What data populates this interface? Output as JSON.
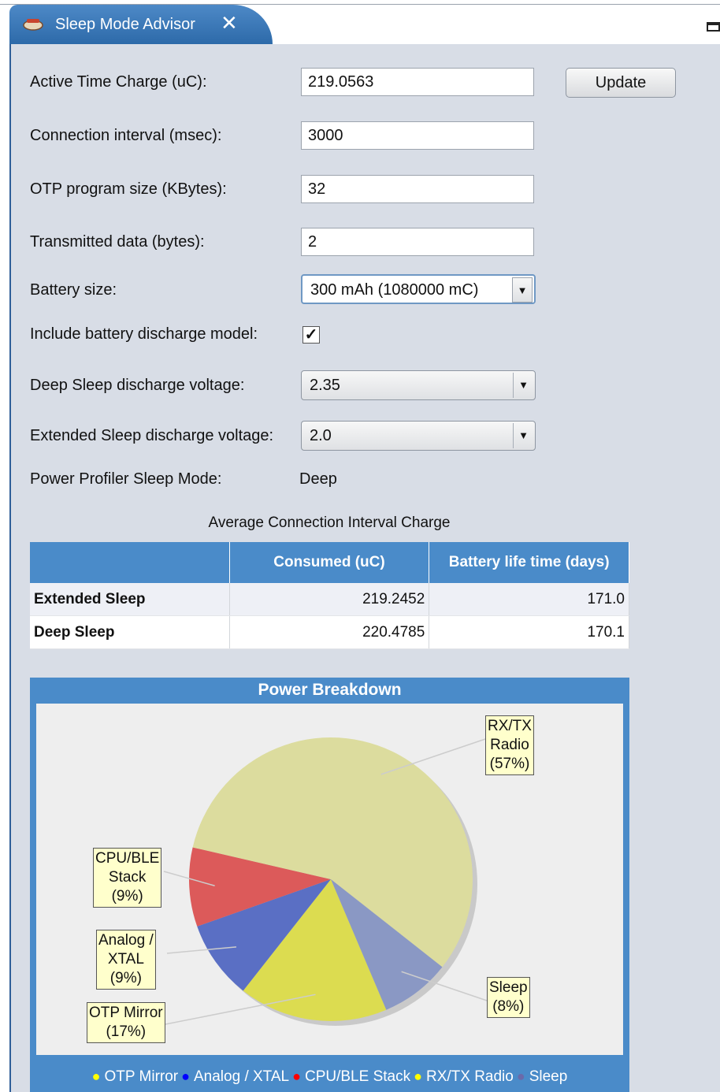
{
  "tab": {
    "icon": "app-icon",
    "title": "Sleep Mode Advisor",
    "close": "✕"
  },
  "fields": {
    "active_charge": {
      "label": "Active Time Charge (uC):",
      "value": "219.0563"
    },
    "conn_interval": {
      "label": "Connection interval (msec):",
      "value": "3000"
    },
    "otp_size": {
      "label": "OTP program size (KBytes):",
      "value": "32"
    },
    "tx_data": {
      "label": "Transmitted data (bytes):",
      "value": "2"
    },
    "battery": {
      "label": "Battery size:",
      "value": "300 mAh (1080000 mC)"
    },
    "discharge_model": {
      "label": "Include battery discharge model:",
      "checked": true,
      "mark": "✓"
    },
    "deep_voltage": {
      "label": "Deep Sleep discharge voltage:",
      "value": "2.35"
    },
    "ext_voltage": {
      "label": "Extended Sleep discharge voltage:",
      "value": "2.0"
    },
    "profiler_mode": {
      "label": "Power Profiler Sleep Mode:",
      "value": "Deep"
    }
  },
  "update_button": "Update",
  "table": {
    "caption": "Average Connection Interval Charge",
    "headers": [
      "",
      "Consumed (uC)",
      "Battery life time (days)"
    ],
    "rows": [
      [
        "Extended Sleep",
        "219.2452",
        "171.0"
      ],
      [
        "Deep Sleep",
        "220.4785",
        "170.1"
      ]
    ]
  },
  "chart_data": {
    "type": "pie",
    "title": "Power Breakdown",
    "slices": [
      {
        "name": "OTP Mirror",
        "label": "OTP Mirror (17%)",
        "value": 17,
        "color": "#dcdc50",
        "legend_dot": "#ffff00"
      },
      {
        "name": "Analog / XTAL",
        "label": "Analog / XTAL (9%)",
        "value": 9,
        "color": "#5a6fc4",
        "legend_dot": "#0000ff"
      },
      {
        "name": "CPU/BLE Stack",
        "label": "CPU/BLE Stack (9%)",
        "value": 9,
        "color": "#dc5a5a",
        "legend_dot": "#ff0000"
      },
      {
        "name": "RX/TX Radio",
        "label": "RX/TX Radio (57%)",
        "value": 57,
        "color": "#dcdc9e",
        "legend_dot": "#ffff00"
      },
      {
        "name": "Sleep",
        "label": "Sleep (8%)",
        "value": 8,
        "color": "#8a98c4",
        "legend_dot": "#6a6aaa"
      }
    ],
    "legend_position": "bottom",
    "callout_text": {
      "OTP Mirror": [
        "OTP Mirror",
        "(17%)"
      ],
      "Analog / XTAL": [
        "Analog /",
        "XTAL",
        "(9%)"
      ],
      "CPU/BLE Stack": [
        "CPU/BLE",
        "Stack",
        "(9%)"
      ],
      "RX/TX Radio": [
        "RX/TX",
        "Radio",
        "(57%)"
      ],
      "Sleep": [
        "Sleep",
        "(8%)"
      ]
    }
  },
  "icons": {
    "dropdown": "▼"
  }
}
